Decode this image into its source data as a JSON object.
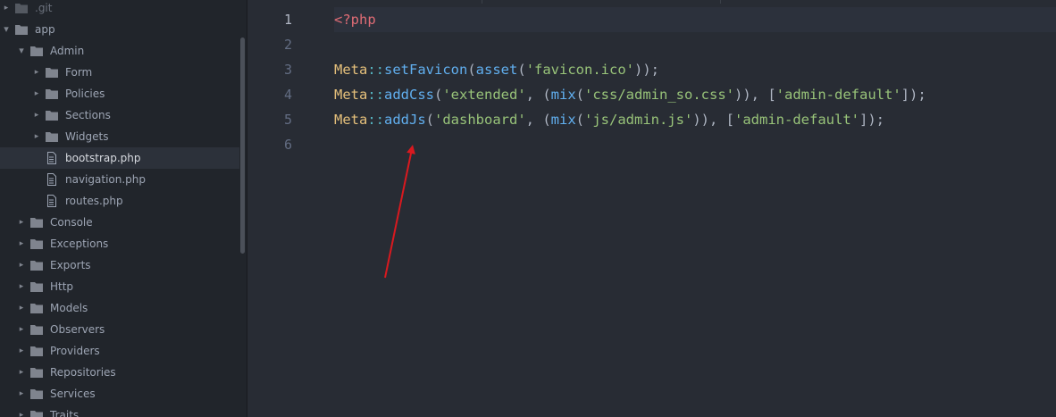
{
  "tree": [
    {
      "label": ".git",
      "type": "folder",
      "depth": 0,
      "expanded": false,
      "dim": true
    },
    {
      "label": "app",
      "type": "folder",
      "depth": 0,
      "expanded": true
    },
    {
      "label": "Admin",
      "type": "folder",
      "depth": 1,
      "expanded": true
    },
    {
      "label": "Form",
      "type": "folder",
      "depth": 2,
      "expanded": false
    },
    {
      "label": "Policies",
      "type": "folder",
      "depth": 2,
      "expanded": false
    },
    {
      "label": "Sections",
      "type": "folder",
      "depth": 2,
      "expanded": false
    },
    {
      "label": "Widgets",
      "type": "folder",
      "depth": 2,
      "expanded": false
    },
    {
      "label": "bootstrap.php",
      "type": "file",
      "depth": 2,
      "selected": true
    },
    {
      "label": "navigation.php",
      "type": "file",
      "depth": 2
    },
    {
      "label": "routes.php",
      "type": "file",
      "depth": 2
    },
    {
      "label": "Console",
      "type": "folder",
      "depth": 1,
      "expanded": false
    },
    {
      "label": "Exceptions",
      "type": "folder",
      "depth": 1,
      "expanded": false
    },
    {
      "label": "Exports",
      "type": "folder",
      "depth": 1,
      "expanded": false
    },
    {
      "label": "Http",
      "type": "folder",
      "depth": 1,
      "expanded": false
    },
    {
      "label": "Models",
      "type": "folder",
      "depth": 1,
      "expanded": false
    },
    {
      "label": "Observers",
      "type": "folder",
      "depth": 1,
      "expanded": false
    },
    {
      "label": "Providers",
      "type": "folder",
      "depth": 1,
      "expanded": false
    },
    {
      "label": "Repositories",
      "type": "folder",
      "depth": 1,
      "expanded": false
    },
    {
      "label": "Services",
      "type": "folder",
      "depth": 1,
      "expanded": false
    },
    {
      "label": "Traits",
      "type": "folder",
      "depth": 1,
      "expanded": false
    }
  ],
  "editor": {
    "active_line": 1,
    "line_numbers": [
      "1",
      "2",
      "3",
      "4",
      "5",
      "6"
    ],
    "lines": [
      [
        {
          "t": "tag",
          "s": "<?php"
        }
      ],
      [],
      [
        {
          "t": "cls",
          "s": "Meta"
        },
        {
          "t": "op",
          "s": "::"
        },
        {
          "t": "fn",
          "s": "setFavicon"
        },
        {
          "t": "pun",
          "s": "("
        },
        {
          "t": "fn",
          "s": "asset"
        },
        {
          "t": "pun",
          "s": "("
        },
        {
          "t": "str",
          "s": "'favicon.ico'"
        },
        {
          "t": "pun",
          "s": "));"
        }
      ],
      [
        {
          "t": "cls",
          "s": "Meta"
        },
        {
          "t": "op",
          "s": "::"
        },
        {
          "t": "fn",
          "s": "addCss"
        },
        {
          "t": "pun",
          "s": "("
        },
        {
          "t": "str",
          "s": "'extended'"
        },
        {
          "t": "pun",
          "s": ", ("
        },
        {
          "t": "fn",
          "s": "mix"
        },
        {
          "t": "pun",
          "s": "("
        },
        {
          "t": "str",
          "s": "'css/admin_so.css'"
        },
        {
          "t": "pun",
          "s": ")), ["
        },
        {
          "t": "str",
          "s": "'admin-default'"
        },
        {
          "t": "pun",
          "s": "]);"
        }
      ],
      [
        {
          "t": "cls",
          "s": "Meta"
        },
        {
          "t": "op",
          "s": "::"
        },
        {
          "t": "fn",
          "s": "addJs"
        },
        {
          "t": "pun",
          "s": "("
        },
        {
          "t": "str",
          "s": "'dashboard'"
        },
        {
          "t": "pun",
          "s": ", ("
        },
        {
          "t": "fn",
          "s": "mix"
        },
        {
          "t": "pun",
          "s": "("
        },
        {
          "t": "str",
          "s": "'js/admin.js'"
        },
        {
          "t": "pun",
          "s": ")), ["
        },
        {
          "t": "str",
          "s": "'admin-default'"
        },
        {
          "t": "pun",
          "s": "]);"
        }
      ],
      []
    ]
  },
  "colors": {
    "sidebar_bg": "#21252b",
    "editor_bg": "#282c34",
    "arrow": "#d9191f",
    "folder": "#7f848e",
    "selected_row": "#2c313a"
  }
}
